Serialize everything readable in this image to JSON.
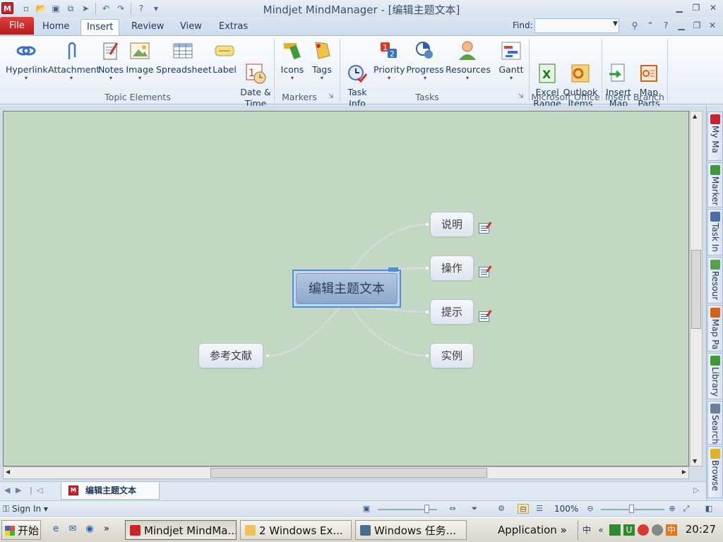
{
  "window": {
    "title": "Mindjet MindManager - [编辑主题文本]",
    "logo": "M"
  },
  "qat": {
    "icons": [
      "new-icon",
      "open-icon",
      "save-icon",
      "save-all-icon",
      "send-icon",
      "undo-icon",
      "redo-icon",
      "help-icon"
    ]
  },
  "tabs": {
    "file": "File",
    "items": [
      "Home",
      "Insert",
      "Review",
      "View",
      "Extras"
    ],
    "active": "Insert",
    "find_label": "Find:",
    "find_value": ""
  },
  "ribbon": {
    "groups": [
      {
        "label": "Topic Elements"
      },
      {
        "label": "Markers"
      },
      {
        "label": "Tasks"
      },
      {
        "label": "Microsoft Office"
      },
      {
        "label": "Insert Branch"
      }
    ],
    "buttons": {
      "hyperlink": "Hyperlink",
      "attachment": "Attachment",
      "notes": "Notes",
      "image": "Image",
      "spreadsheet": "Spreadsheet",
      "label": "Label",
      "date_time": "Date &\nTime",
      "icons": "Icons",
      "tags": "Tags",
      "task_info": "Task\nInfo",
      "priority": "Priority",
      "progress": "Progress",
      "resources": "Resources",
      "gantt": "Gantt",
      "excel_range": "Excel\nRange",
      "outlook_items": "Outlook\nItems",
      "insert_map": "Insert\nMap",
      "map_parts": "Map\nParts"
    }
  },
  "map": {
    "central_topic": "编辑主题文本",
    "subtopics": [
      "说明",
      "操作",
      "提示",
      "实例"
    ],
    "left_topic": "参考文献"
  },
  "side_panel": {
    "tabs": [
      "My Ma",
      "Marker",
      "Task In",
      "Resour",
      "Map Pa",
      "Library",
      "Search",
      "Browse"
    ]
  },
  "doc_tab": {
    "label": "编辑主题文本"
  },
  "status": {
    "sign_in": "Sign In",
    "zoom": "100%"
  },
  "taskbar": {
    "start": "开始",
    "buttons": [
      "Mindjet MindMa...",
      "2 Windows Ex...",
      "Windows 任务..."
    ],
    "application": "Application",
    "ime": "中",
    "time": "20:27"
  },
  "colors": {
    "canvas_bg": "#c2d8c2",
    "central_topic": "#9fb6d8",
    "selection": "#4c8fd6",
    "file_tab": "#c9232b"
  }
}
